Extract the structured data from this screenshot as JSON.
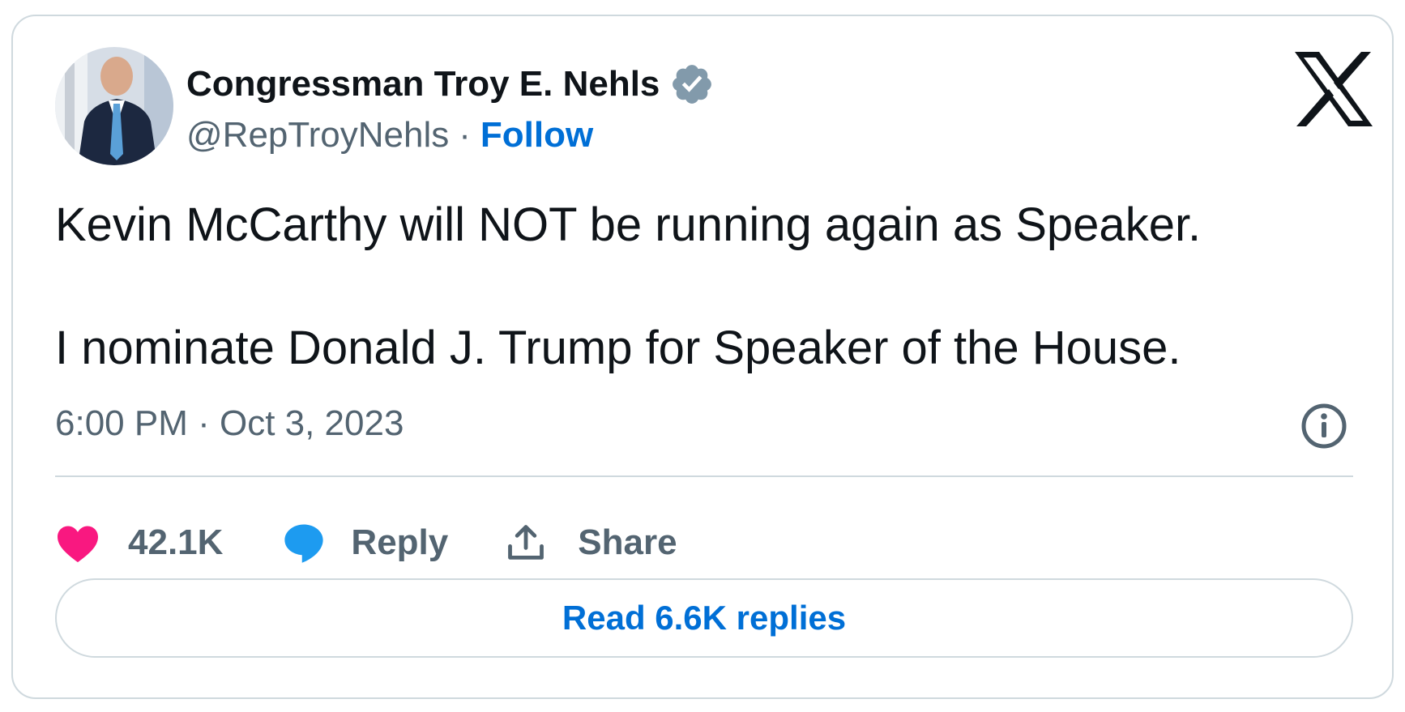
{
  "author": {
    "display_name": "Congressman Troy E. Nehls",
    "handle": "@RepTroyNehls",
    "separator": "·",
    "follow_label": "Follow",
    "verified_icon": "verified-badge-icon",
    "verified_color": "#829aab"
  },
  "brand": {
    "logo_icon": "x-logo-icon",
    "color": "#0f1419"
  },
  "tweet": {
    "paragraphs": [
      "Kevin McCarthy will NOT be running again as Speaker.",
      "I nominate Donald J. Trump for Speaker of the House."
    ],
    "timestamp": "6:00 PM · Oct 3, 2023",
    "info_icon": "info-icon"
  },
  "actions": {
    "like": {
      "icon": "heart-icon",
      "label": "42.1K",
      "color": "#f91880"
    },
    "reply": {
      "icon": "speech-bubble-icon",
      "label": "Reply",
      "color": "#1d9bf0"
    },
    "share": {
      "icon": "share-upload-icon",
      "label": "Share",
      "color": "#536471"
    }
  },
  "read_replies_label": "Read 6.6K replies",
  "colors": {
    "link": "#006fd6",
    "text_primary": "#0f1419",
    "text_secondary": "#536471",
    "border": "#cfd9de"
  }
}
